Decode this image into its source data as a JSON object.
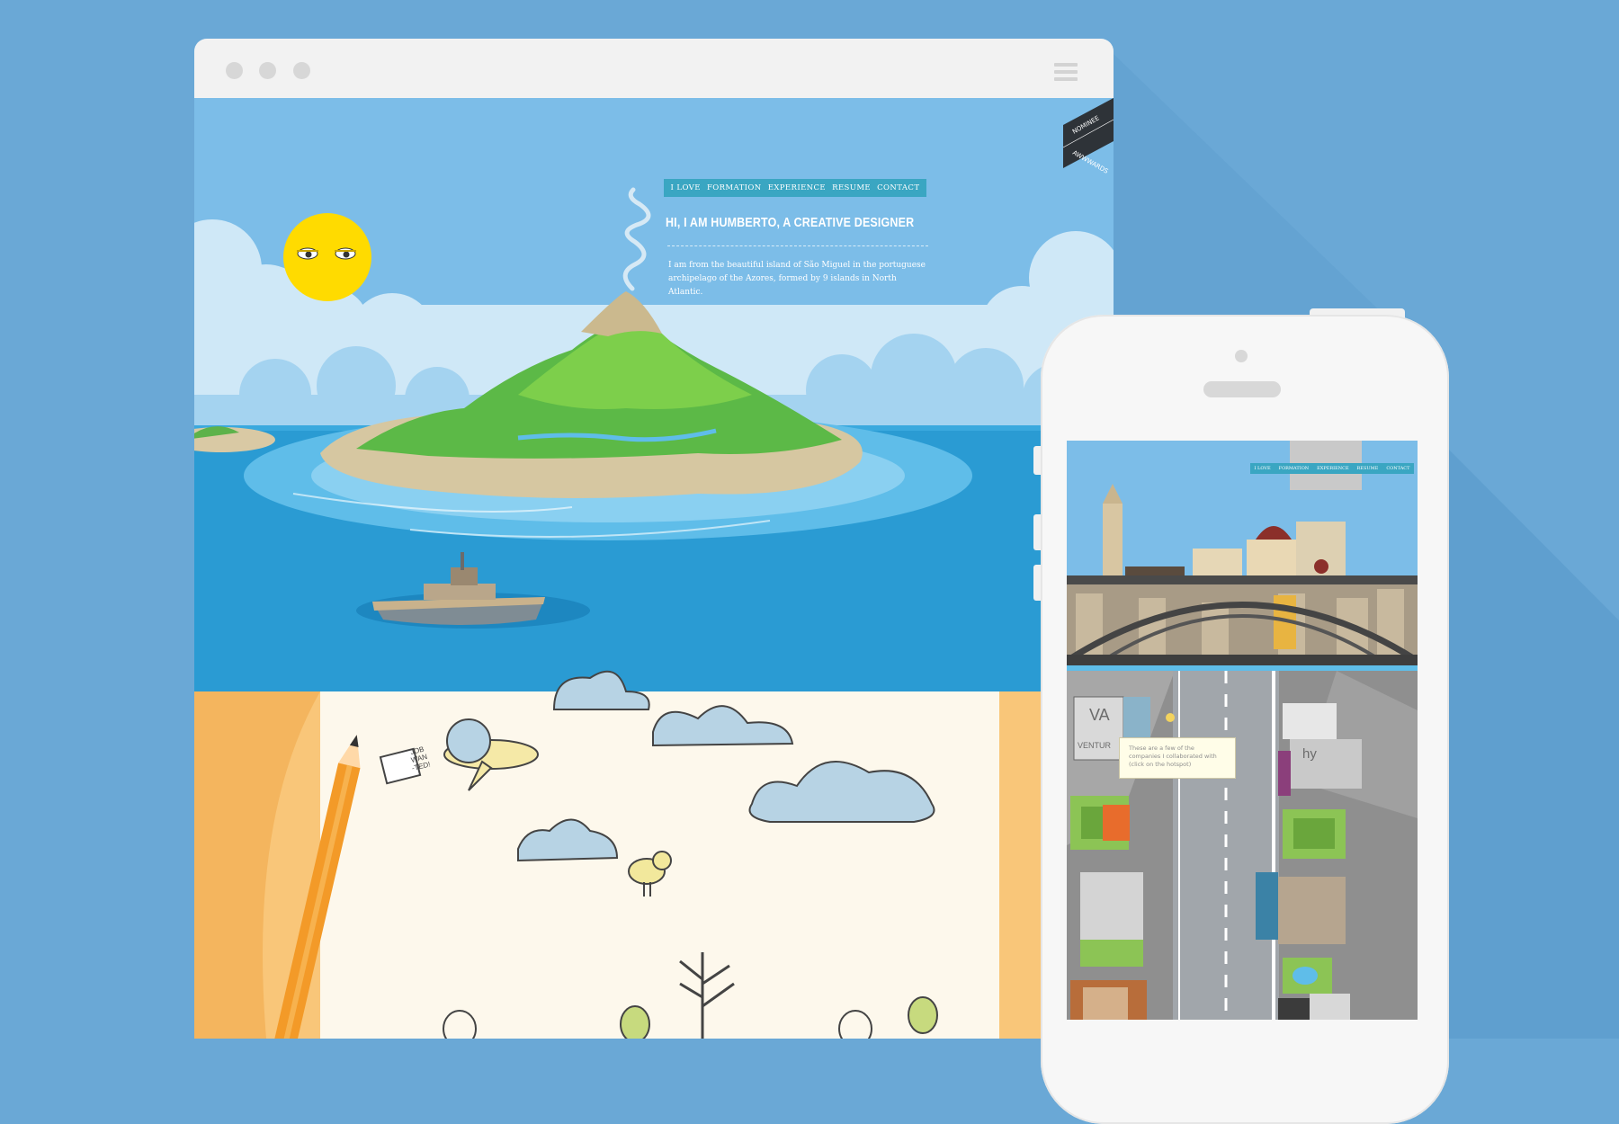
{
  "desktop": {
    "nav": [
      "I LOVE",
      "FORMATION",
      "EXPERIENCE",
      "RESUME",
      "CONTACT"
    ],
    "headline": "HI, I AM HUMBERTO, A CREATIVE DESIGNER",
    "intro": "I am from the beautiful island of São Miguel in the portuguese archipelago of the Azores, formed by 9 islands in North Atlantic.",
    "ribbon_top": "NOMINEE",
    "ribbon_bottom": "AWWWARDS",
    "tag_text": [
      "JOB",
      "WAN",
      "-TED!"
    ]
  },
  "mobile": {
    "nav": [
      "I LOVE",
      "FORMATION",
      "EXPERIENCE",
      "RESUME",
      "CONTACT"
    ],
    "tooltip": [
      "These are a few of the",
      "companies I collaborated with",
      "(click on the hotspot)"
    ],
    "logo_va": "VA",
    "logo_ventur": "VENTUR",
    "logo_hy": "hy"
  },
  "colors": {
    "background": "#6aa8d6",
    "sky": "#7cbde8",
    "sea": "#2aa0d6",
    "nav": "#3aa6c2",
    "sun": "#ffdb00",
    "paper": "#fdf8ec"
  }
}
